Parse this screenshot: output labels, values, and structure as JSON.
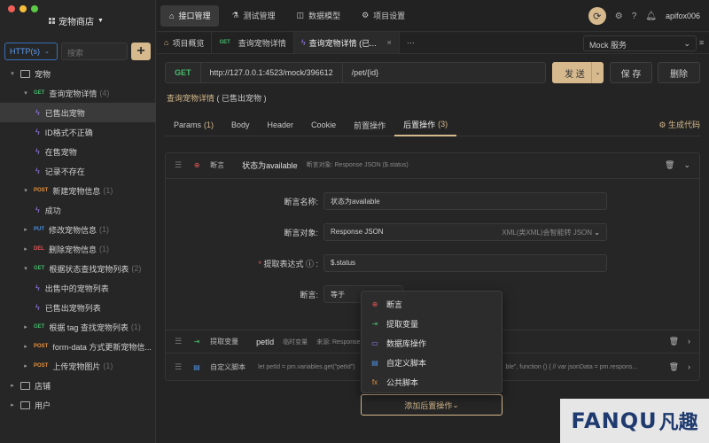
{
  "project": {
    "name": "宠物商店"
  },
  "sidebar": {
    "http_select": "HTTP(s)",
    "search_placeholder": "搜索",
    "tree": [
      {
        "type": "folder",
        "label": "宠物",
        "depth": 0,
        "open": true
      },
      {
        "type": "api",
        "method": "GET",
        "label": "查询宠物详情",
        "count": "(4)",
        "depth": 1
      },
      {
        "type": "case",
        "label": "已售出宠物",
        "depth": 2,
        "selected": true
      },
      {
        "type": "case",
        "label": "ID格式不正确",
        "depth": 2
      },
      {
        "type": "case",
        "label": "在售宠物",
        "depth": 2
      },
      {
        "type": "case",
        "label": "记录不存在",
        "depth": 2
      },
      {
        "type": "api",
        "method": "POST",
        "label": "新建宠物信息",
        "count": "(1)",
        "depth": 1
      },
      {
        "type": "case",
        "label": "成功",
        "depth": 2
      },
      {
        "type": "api",
        "method": "PUT",
        "label": "修改宠物信息",
        "count": "(1)",
        "depth": 1,
        "collapsed": true
      },
      {
        "type": "api",
        "method": "DEL",
        "label": "删除宠物信息",
        "count": "(1)",
        "depth": 1,
        "collapsed": true
      },
      {
        "type": "api",
        "method": "GET",
        "label": "根据状态查找宠物列表",
        "count": "(2)",
        "depth": 1
      },
      {
        "type": "case",
        "label": "出售中的宠物列表",
        "depth": 2
      },
      {
        "type": "case",
        "label": "已售出宠物列表",
        "depth": 2
      },
      {
        "type": "api",
        "method": "GET",
        "label": "根据 tag 查找宠物列表",
        "count": "(1)",
        "depth": 1,
        "collapsed": true
      },
      {
        "type": "api",
        "method": "POST",
        "label": "form-data 方式更新宠物信...",
        "count": "",
        "depth": 1,
        "collapsed": true
      },
      {
        "type": "api",
        "method": "POST",
        "label": "上传宠物图片",
        "count": "(1)",
        "depth": 1,
        "collapsed": true
      },
      {
        "type": "folder",
        "label": "店铺",
        "depth": 0,
        "open": false
      },
      {
        "type": "folder",
        "label": "用户",
        "depth": 0,
        "open": false
      }
    ]
  },
  "topnav": {
    "items": [
      "接口管理",
      "测试管理",
      "数据模型",
      "项目设置"
    ],
    "active": 0,
    "user": "apifox006"
  },
  "tabs": {
    "items": [
      {
        "icon": "home",
        "label": "项目概览"
      },
      {
        "icon": "GET",
        "label": "查询宠物详情"
      },
      {
        "icon": "zap",
        "label": "查询宠物详情 (已..."
      }
    ],
    "active": 2,
    "more": "···",
    "mock": "Mock 服务"
  },
  "request": {
    "method": "GET",
    "url": "http://127.0.0.1:4523/mock/396612",
    "path": "/pet/{id}",
    "send": "发 送",
    "save": "保 存",
    "delete": "删除"
  },
  "breadcrumb": {
    "name": "查询宠物详情",
    "suffix": "( 已售出宠物 )"
  },
  "subtabs": {
    "items": [
      {
        "label": "Params",
        "count": "(1)"
      },
      {
        "label": "Body",
        "count": ""
      },
      {
        "label": "Header",
        "count": ""
      },
      {
        "label": "Cookie",
        "count": ""
      },
      {
        "label": "前置操作",
        "count": ""
      },
      {
        "label": "后置操作",
        "count": "(3)"
      }
    ],
    "active": 5,
    "gen_code": "生成代码"
  },
  "assert_row": {
    "kind": "断言",
    "title": "状态为available",
    "sub": "断言对象: Response JSON ($.status)"
  },
  "form": {
    "name_label": "断言名称:",
    "name_value": "状态为available",
    "target_label": "断言对象:",
    "target_value": "Response JSON",
    "target_hint": "XML(类XML)会智能转 JSON",
    "expr_label": "提取表达式",
    "expr_value": "$.status",
    "assert_label": "断言:",
    "assert_value": "等于"
  },
  "extract_row": {
    "kind": "提取变量",
    "title": "petId",
    "sub1": "临时变量",
    "sub2": "来源: Response ..."
  },
  "script_row": {
    "kind": "自定义脚本",
    "code": "let petId = pm.variables.get(\"petId\")",
    "code2": "ble\", function () { // var jsonData = pm.respons..."
  },
  "dropdown": {
    "items": [
      {
        "icon": "断言",
        "label": "断言"
      },
      {
        "icon": "提取",
        "label": "提取变量"
      },
      {
        "icon": "db",
        "label": "数据库操作"
      },
      {
        "icon": "script",
        "label": "自定义脚本"
      },
      {
        "icon": "fx",
        "label": "公共脚本"
      }
    ]
  },
  "add_post": "添加后置操作",
  "watermark": {
    "a": "FANQU",
    "b": "凡趣"
  },
  "colors": {
    "accent": "#d6b98c",
    "get": "#46b96b",
    "post": "#e8913a",
    "put": "#4a90e2",
    "del": "#e05555"
  }
}
